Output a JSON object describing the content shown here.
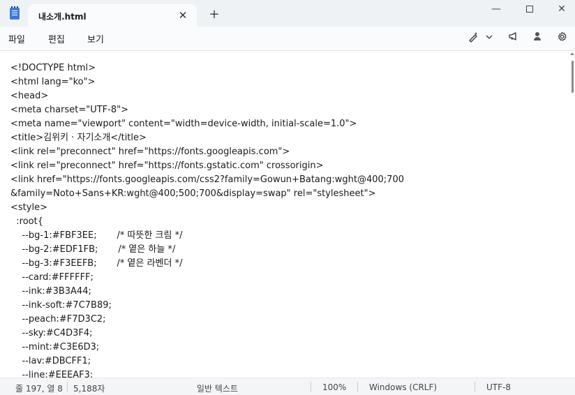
{
  "window": {
    "tab_title": "내소개.html",
    "tab_close": "✕",
    "new_tab": "+",
    "minimize": "—",
    "close": "✕"
  },
  "menu": {
    "file": "파일",
    "edit": "편집",
    "view": "보기"
  },
  "toolbar_icons": [
    "ai-rewrite-icon",
    "chevron-down-icon",
    "megaphone-icon",
    "account-icon",
    "gear-icon"
  ],
  "editor": {
    "lines": [
      "<!DOCTYPE html>",
      "<html lang=\"ko\">",
      "<head>",
      "<meta charset=\"UTF-8\">",
      "<meta name=\"viewport\" content=\"width=device-width, initial-scale=1.0\">",
      "<title>김위키 · 자기소개</title>",
      "<link rel=\"preconnect\" href=\"https://fonts.googleapis.com\">",
      "<link rel=\"preconnect\" href=\"https://fonts.gstatic.com\" crossorigin>",
      "<link href=\"https://fonts.googleapis.com/css2?family=Gowun+Batang:wght@400;700",
      "&family=Noto+Sans+KR:wght@400;500;700&display=swap\" rel=\"stylesheet\">",
      "<style>",
      "  :root{",
      "    --bg-1:#FBF3EE;       /* 따뜻한 크림 */",
      "    --bg-2:#EDF1FB;       /* 옅은 하늘 */",
      "    --bg-3:#F3EEFB;       /* 옅은 라벤더 */",
      "    --card:#FFFFFF;",
      "    --ink:#3B3A44;",
      "    --ink-soft:#7C7B89;",
      "    --peach:#F7D3C2;",
      "    --sky:#C4D3F4;",
      "    --mint:#C3E6D3;",
      "    --lav:#DBCFF1;",
      "    --line:#EEEAF3;"
    ]
  },
  "status": {
    "position": "줄 197, 열 8",
    "chars": "5,188자",
    "format": "일반 텍스트",
    "zoom": "100%",
    "line_ending": "Windows (CRLF)",
    "encoding": "UTF-8"
  }
}
